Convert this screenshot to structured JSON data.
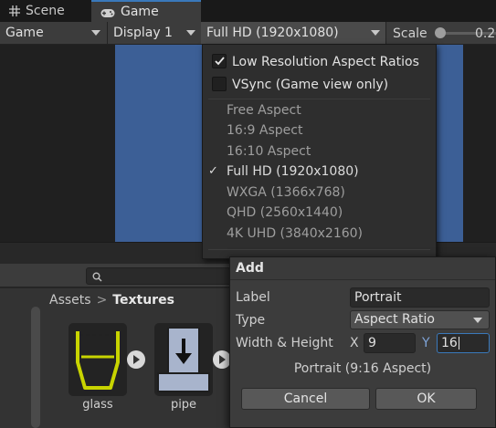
{
  "tabs": [
    {
      "label": "Scene",
      "icon": "grid-icon"
    },
    {
      "label": "Game",
      "icon": "gamepad-icon"
    }
  ],
  "toolbar": {
    "display_mode": "Game",
    "display": "Display 1",
    "resolution": "Full HD (1920x1080)",
    "scale_label": "Scale",
    "scale_value": "0.2",
    "scale_fraction": 0.05
  },
  "aspect_menu": {
    "checkbox_items": [
      {
        "label": "Low Resolution Aspect Ratios",
        "checked": true
      },
      {
        "label": "VSync (Game view only)",
        "checked": false
      }
    ],
    "options": [
      {
        "label": "Free Aspect",
        "selected": false
      },
      {
        "label": "16:9 Aspect",
        "selected": false
      },
      {
        "label": "16:10 Aspect",
        "selected": false
      },
      {
        "label": "Full HD (1920x1080)",
        "selected": true
      },
      {
        "label": "WXGA (1366x768)",
        "selected": false
      },
      {
        "label": "QHD (2560x1440)",
        "selected": false
      },
      {
        "label": "4K UHD (3840x2160)",
        "selected": false
      }
    ],
    "check_glyph": "✓"
  },
  "dialog": {
    "title": "Add",
    "label_caption": "Label",
    "label_value": "Portrait",
    "type_caption": "Type",
    "type_value": "Aspect Ratio",
    "size_caption": "Width & Height",
    "x_caption": "X",
    "x_value": "9",
    "y_caption": "Y",
    "y_value": "16",
    "summary": "Portrait (9:16 Aspect)",
    "cancel_label": "Cancel",
    "ok_label": "OK"
  },
  "project": {
    "breadcrumb": [
      "Assets",
      "Textures"
    ],
    "breadcrumb_sep": ">",
    "assets": [
      {
        "label": "glass",
        "icon": "glass-texture-icon"
      },
      {
        "label": "pipe",
        "icon": "pipe-texture-icon"
      }
    ]
  },
  "colors": {
    "accent": "#3a79bb",
    "game_view_blue": "#3c5f96",
    "glass_outline": "#c8d400"
  }
}
